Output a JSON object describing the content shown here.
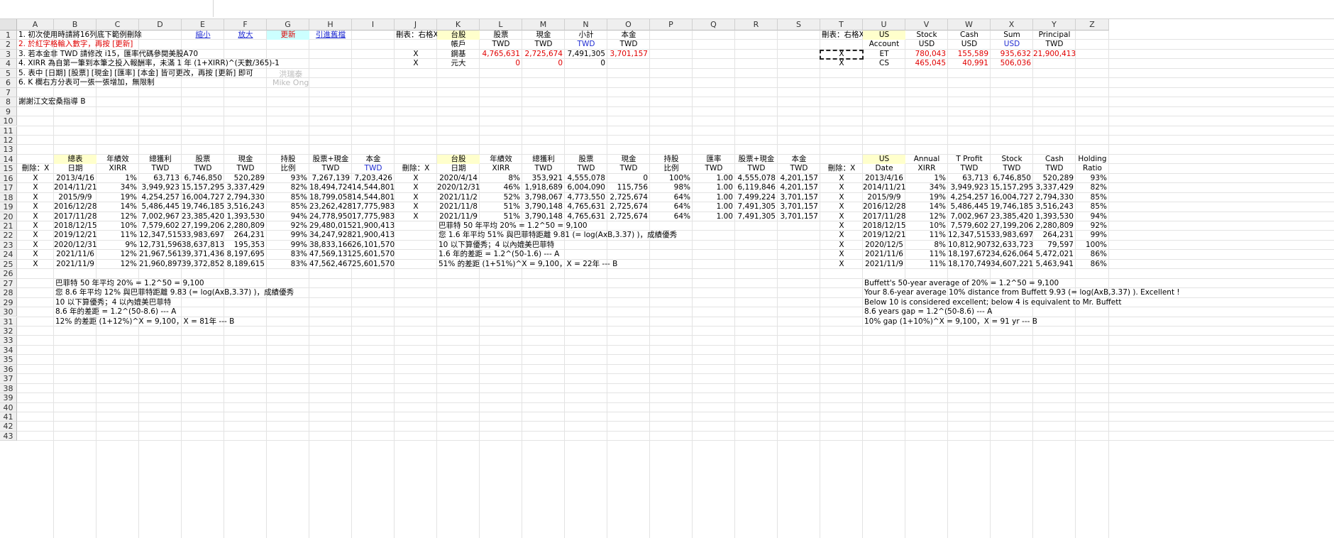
{
  "columns": [
    "A",
    "B",
    "C",
    "D",
    "E",
    "F",
    "G",
    "H",
    "I",
    "J",
    "K",
    "L",
    "M",
    "N",
    "O",
    "P",
    "Q",
    "R",
    "S",
    "T",
    "U",
    "V",
    "W",
    "X",
    "Y",
    "Z"
  ],
  "rows": 43,
  "watermark": {
    "line1": "洪瑞泰",
    "line2": "Mike Ong"
  },
  "notes": {
    "n1": "1. 初次使用時請將16列底下範例刪除",
    "n2": "2. 於紅字格輸入數字，再按 [更新]",
    "n3": "3. 若本金非 TWD 請修改 i15，匯率代碼參閱美股A70",
    "n4": "4. XIRR 為自第一筆到本筆之投入報酬率，未滿 1 年 (1+XIRR)^(天數/365)-1",
    "n5": "5. 表中 [日期] [股票] [現金] [匯率] [本金] 皆可更改，再按 [更新] 即可",
    "n6": "6. K 欄右方分表可一張一張增加，無限制",
    "n8": "謝謝江文宏桑指導 B"
  },
  "links": {
    "shrink": "縮小",
    "enlarge": "放大",
    "update": "更新",
    "import": "引進舊檔"
  },
  "tw_accounts": {
    "del_label": "刪表：右格X",
    "headers": [
      "台股",
      "股票",
      "現金",
      "小計",
      "本金"
    ],
    "subheaders": [
      "帳戶",
      "TWD",
      "TWD",
      "TWD",
      "TWD"
    ],
    "rows": [
      {
        "x": "X",
        "name": "鋼基",
        "stock": "4,765,631",
        "cash": "2,725,674",
        "sum": "7,491,305",
        "principal": "3,701,157"
      },
      {
        "x": "X",
        "name": "元大",
        "stock": "0",
        "cash": "0",
        "sum": "0",
        "principal": ""
      }
    ]
  },
  "us_accounts": {
    "del_label": "刪表：右格X",
    "headers": [
      "US",
      "Stock",
      "Cash",
      "Sum",
      "Principal"
    ],
    "subheaders": [
      "Account",
      "USD",
      "USD",
      "USD",
      "TWD"
    ],
    "rows": [
      {
        "x": "X",
        "name": "ET",
        "stock": "780,043",
        "cash": "155,589",
        "sum": "935,632",
        "principal": "21,900,413"
      },
      {
        "x": "X",
        "name": "CS",
        "stock": "465,045",
        "cash": "40,991",
        "sum": "506,036",
        "principal": ""
      }
    ]
  },
  "total_table": {
    "del_label": "刪除：X",
    "headers": [
      "總表",
      "年績效",
      "總獲利",
      "股票",
      "現金",
      "持股",
      "股票+現金",
      "本金"
    ],
    "subheaders": [
      "日期",
      "XIRR",
      "TWD",
      "TWD",
      "TWD",
      "比例",
      "TWD",
      "TWD"
    ],
    "rows": [
      [
        "X",
        "2013/4/16",
        "1%",
        "63,713",
        "6,746,850",
        "520,289",
        "93%",
        "7,267,139",
        "7,203,426"
      ],
      [
        "X",
        "2014/11/21",
        "34%",
        "3,949,923",
        "15,157,295",
        "3,337,429",
        "82%",
        "18,494,724",
        "14,544,801"
      ],
      [
        "X",
        "2015/9/9",
        "19%",
        "4,254,257",
        "16,004,727",
        "2,794,330",
        "85%",
        "18,799,058",
        "14,544,801"
      ],
      [
        "X",
        "2016/12/28",
        "14%",
        "5,486,445",
        "19,746,185",
        "3,516,243",
        "85%",
        "23,262,428",
        "17,775,983"
      ],
      [
        "X",
        "2017/11/28",
        "12%",
        "7,002,967",
        "23,385,420",
        "1,393,530",
        "94%",
        "24,778,950",
        "17,775,983"
      ],
      [
        "X",
        "2018/12/15",
        "10%",
        "7,579,602",
        "27,199,206",
        "2,280,809",
        "92%",
        "29,480,015",
        "21,900,413"
      ],
      [
        "X",
        "2019/12/21",
        "11%",
        "12,347,515",
        "33,983,697",
        "264,231",
        "99%",
        "34,247,928",
        "21,900,413"
      ],
      [
        "X",
        "2020/12/31",
        "9%",
        "12,731,596",
        "38,637,813",
        "195,353",
        "99%",
        "38,833,166",
        "26,101,570"
      ],
      [
        "X",
        "2021/11/6",
        "12%",
        "21,967,561",
        "39,371,436",
        "8,197,695",
        "83%",
        "47,569,131",
        "25,601,570"
      ],
      [
        "X",
        "2021/11/9",
        "12%",
        "21,960,897",
        "39,372,852",
        "8,189,615",
        "83%",
        "47,562,467",
        "25,601,570"
      ]
    ],
    "notes": [
      "巴菲特 50 年平均 20% = 1.2^50 = 9,100",
      "您 8.6 年平均 12% 與巴菲特距離 9.83 (= log(AxB,3.37) )，成績優秀",
      "10 以下算優秀；4 以內媲美巴菲特",
      "8.6 年的差距 = 1.2^(50-8.6) --- A",
      "12% 的差距 (1+12%)^X = 9,100，X = 81年 --- B"
    ]
  },
  "tw_table": {
    "del_label": "刪除：X",
    "headers": [
      "台股",
      "年績效",
      "總獲利",
      "股票",
      "現金",
      "持股",
      "匯率",
      "股票+現金",
      "本金"
    ],
    "subheaders": [
      "日期",
      "XIRR",
      "TWD",
      "TWD",
      "TWD",
      "比例",
      "TWD",
      "TWD",
      "TWD"
    ],
    "rows": [
      [
        "X",
        "2020/4/14",
        "8%",
        "353,921",
        "4,555,078",
        "0",
        "100%",
        "1.00",
        "4,555,078",
        "4,201,157"
      ],
      [
        "X",
        "2020/12/31",
        "46%",
        "1,918,689",
        "6,004,090",
        "115,756",
        "98%",
        "1.00",
        "6,119,846",
        "4,201,157"
      ],
      [
        "X",
        "2021/11/2",
        "52%",
        "3,798,067",
        "4,773,550",
        "2,725,674",
        "64%",
        "1.00",
        "7,499,224",
        "3,701,157"
      ],
      [
        "X",
        "2021/11/8",
        "51%",
        "3,790,148",
        "4,765,631",
        "2,725,674",
        "64%",
        "1.00",
        "7,491,305",
        "3,701,157"
      ],
      [
        "X",
        "2021/11/9",
        "51%",
        "3,790,148",
        "4,765,631",
        "2,725,674",
        "64%",
        "1.00",
        "7,491,305",
        "3,701,157"
      ]
    ],
    "notes": [
      "巴菲特 50 年平均 20% = 1.2^50 = 9,100",
      "您 1.6 年平均 51% 與巴菲特距離 9.81 (= log(AxB,3.37) )，成績優秀",
      "10 以下算優秀；4 以內媲美巴菲特",
      "1.6 年的差距 = 1.2^(50-1.6) --- A",
      "51% 的差距 (1+51%)^X = 9,100，X = 22年 --- B"
    ]
  },
  "us_table": {
    "del_label": "刪除：X",
    "headers": [
      "US",
      "Annual",
      "T Profit",
      "Stock",
      "Cash",
      "Holding"
    ],
    "subheaders": [
      "Date",
      "XIRR",
      "TWD",
      "TWD",
      "TWD",
      "Ratio"
    ],
    "rows": [
      [
        "X",
        "2013/4/16",
        "1%",
        "63,713",
        "6,746,850",
        "520,289",
        "93%"
      ],
      [
        "X",
        "2014/11/21",
        "34%",
        "3,949,923",
        "15,157,295",
        "3,337,429",
        "82%"
      ],
      [
        "X",
        "2015/9/9",
        "19%",
        "4,254,257",
        "16,004,727",
        "2,794,330",
        "85%"
      ],
      [
        "X",
        "2016/12/28",
        "14%",
        "5,486,445",
        "19,746,185",
        "3,516,243",
        "85%"
      ],
      [
        "X",
        "2017/11/28",
        "12%",
        "7,002,967",
        "23,385,420",
        "1,393,530",
        "94%"
      ],
      [
        "X",
        "2018/12/15",
        "10%",
        "7,579,602",
        "27,199,206",
        "2,280,809",
        "92%"
      ],
      [
        "X",
        "2019/12/21",
        "11%",
        "12,347,515",
        "33,983,697",
        "264,231",
        "99%"
      ],
      [
        "X",
        "2020/12/5",
        "8%",
        "10,812,907",
        "32,633,723",
        "79,597",
        "100%"
      ],
      [
        "X",
        "2021/11/6",
        "11%",
        "18,197,672",
        "34,626,064",
        "5,472,021",
        "86%"
      ],
      [
        "X",
        "2021/11/9",
        "11%",
        "18,170,749",
        "34,607,221",
        "5,463,941",
        "86%"
      ]
    ],
    "notes": [
      "Buffett's 50-year average of 20% = 1.2^50 = 9,100",
      "Your 8.6-year average 10% distance from Buffett 9.93 (= log(AxB,3.37) ). Excellent !",
      "Below 10 is considered excellent; below 4 is equivalent to Mr. Buffett",
      "8.6 years gap = 1.2^(50-8.6) --- A",
      "10% gap (1+10%)^X = 9,100，X = 91 yr --- B"
    ]
  }
}
